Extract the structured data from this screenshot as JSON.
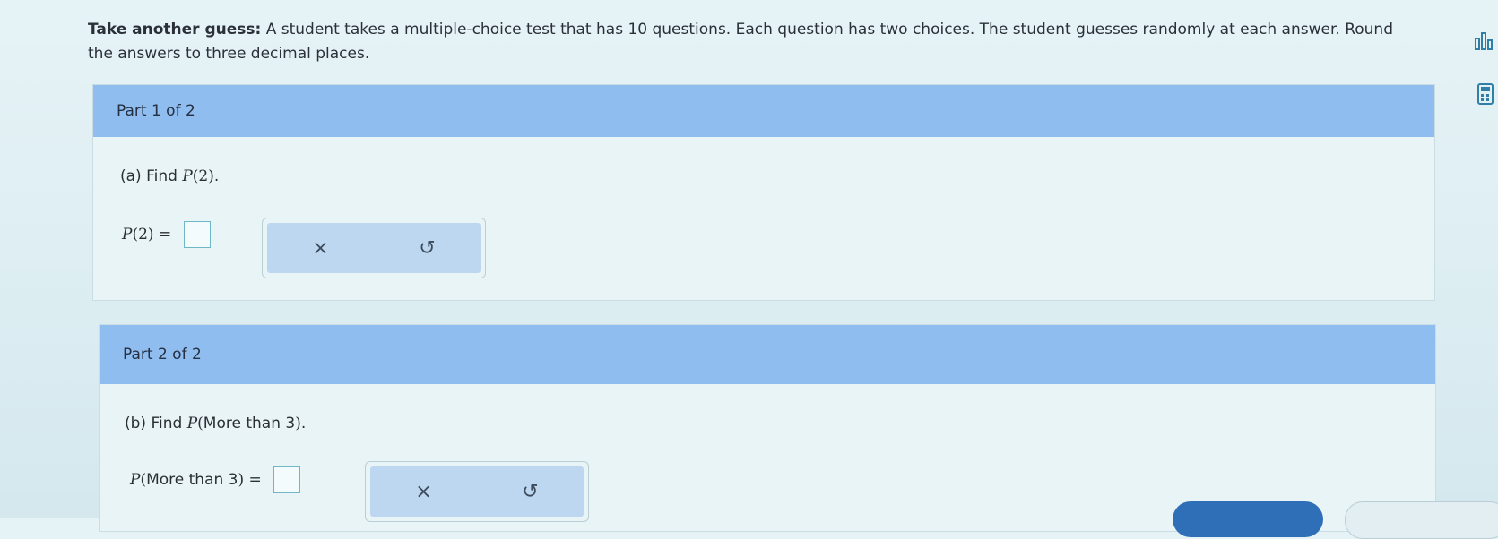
{
  "intro": {
    "bold_lead": "Take another guess:",
    "text": " A student takes a multiple-choice test that has 10 questions. Each question has two choices. The student guesses randomly at each answer. Round the answers to three decimal places."
  },
  "sidebar_icons": [
    "data-chart-icon",
    "calculator-icon"
  ],
  "parts": [
    {
      "header": "Part 1 of 2",
      "prompt_prefix": "(a) Find ",
      "prompt_func": "P",
      "prompt_arg": "2",
      "prompt_suffix": ".",
      "answer_lhs_func": "P",
      "answer_lhs_arg": "2",
      "equals": "=",
      "clear_label": "×",
      "undo_label": "↺"
    },
    {
      "header": "Part 2 of 2",
      "prompt_prefix": "(b) Find ",
      "prompt_func": "P",
      "prompt_arg": "More than 3",
      "prompt_suffix": ".",
      "answer_lhs_func": "P",
      "answer_lhs_arg": "More than 3",
      "equals": "=",
      "clear_label": "×",
      "undo_label": "↺"
    }
  ],
  "colors": {
    "header_blue": "#8fbdf0",
    "answer_border": "#6fb7c6",
    "toolbar_fill": "#bcd7ef",
    "bottom_button": "#2f6fb8"
  }
}
